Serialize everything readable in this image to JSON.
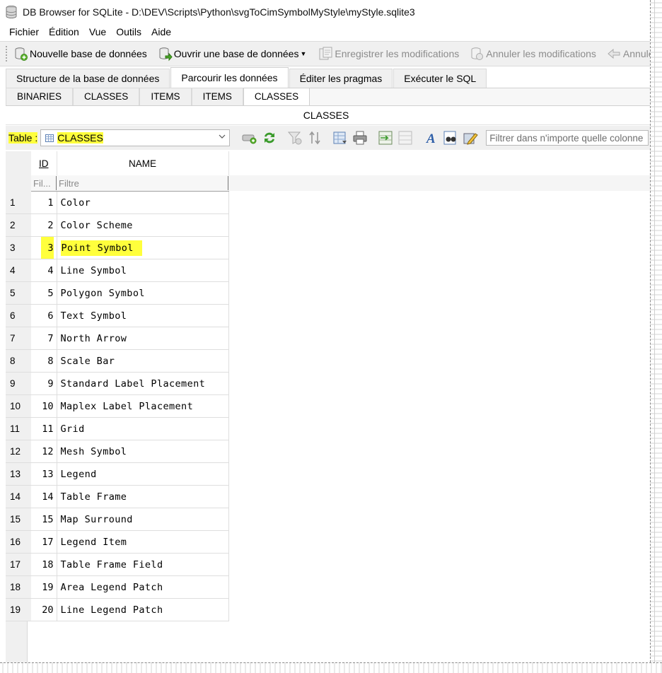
{
  "window": {
    "title": "DB Browser for SQLite - D:\\DEV\\Scripts\\Python\\svgToCimSymbolMyStyle\\myStyle.sqlite3"
  },
  "menu": [
    "Fichier",
    "Édition",
    "Vue",
    "Outils",
    "Aide"
  ],
  "toolbar": {
    "new_db": "Nouvelle base de données",
    "open_db": "Ouvrir une base de données",
    "write_changes": "Enregistrer les modifications",
    "revert_changes": "Annuler les modifications",
    "undo_partial": "Annule"
  },
  "main_tabs": [
    {
      "label": "Structure de la base de données",
      "active": false
    },
    {
      "label": "Parcourir les données",
      "active": true
    },
    {
      "label": "Éditer les pragmas",
      "active": false
    },
    {
      "label": "Exécuter le SQL",
      "active": false
    }
  ],
  "sub_tabs": [
    {
      "label": "BINARIES",
      "active": false
    },
    {
      "label": "CLASSES",
      "active": false
    },
    {
      "label": "ITEMS",
      "active": false
    },
    {
      "label": "ITEMS",
      "active": false
    },
    {
      "label": "CLASSES",
      "active": true
    }
  ],
  "header_title": "CLASSES",
  "table_bar": {
    "label": "Table :",
    "selected_table": "CLASSES",
    "filter_placeholder": "Filtrer dans n'importe quelle colonne"
  },
  "grid": {
    "columns": [
      "ID",
      "NAME"
    ],
    "filter_placeholders": [
      "Fil...",
      "Filtre"
    ],
    "highlight_row": 3,
    "rows": [
      {
        "rownum": "1",
        "id": "1",
        "name": "Color"
      },
      {
        "rownum": "2",
        "id": "2",
        "name": "Color Scheme"
      },
      {
        "rownum": "3",
        "id": "3",
        "name": "Point Symbol"
      },
      {
        "rownum": "4",
        "id": "4",
        "name": "Line Symbol"
      },
      {
        "rownum": "5",
        "id": "5",
        "name": "Polygon Symbol"
      },
      {
        "rownum": "6",
        "id": "6",
        "name": "Text Symbol"
      },
      {
        "rownum": "7",
        "id": "7",
        "name": "North Arrow"
      },
      {
        "rownum": "8",
        "id": "8",
        "name": "Scale Bar"
      },
      {
        "rownum": "9",
        "id": "9",
        "name": "Standard Label Placement"
      },
      {
        "rownum": "10",
        "id": "10",
        "name": "Maplex Label Placement"
      },
      {
        "rownum": "11",
        "id": "11",
        "name": "Grid"
      },
      {
        "rownum": "12",
        "id": "12",
        "name": "Mesh Symbol"
      },
      {
        "rownum": "13",
        "id": "13",
        "name": "Legend"
      },
      {
        "rownum": "14",
        "id": "14",
        "name": "Table Frame"
      },
      {
        "rownum": "15",
        "id": "15",
        "name": "Map Surround"
      },
      {
        "rownum": "16",
        "id": "17",
        "name": "Legend Item"
      },
      {
        "rownum": "17",
        "id": "18",
        "name": "Table Frame Field"
      },
      {
        "rownum": "18",
        "id": "19",
        "name": "Area Legend Patch"
      },
      {
        "rownum": "19",
        "id": "20",
        "name": "Line Legend Patch"
      }
    ]
  },
  "colors": {
    "highlight": "#ffff3c",
    "toolbar_bg": "#f0f0f0"
  }
}
